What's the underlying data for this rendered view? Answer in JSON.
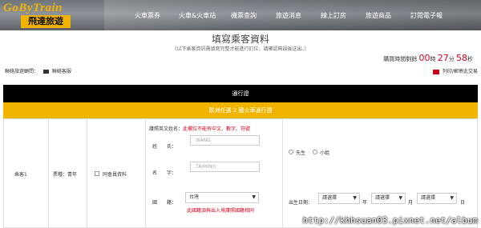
{
  "logo": {
    "en": "GoByTrain",
    "cn": "飛達旅遊"
  },
  "nav": [
    "火車票券",
    "火車&火車站",
    "機票查詢",
    "旅遊消息",
    "線上訂房",
    "旅遊商品",
    "訂閱電子報"
  ],
  "page": {
    "title": "填寫乘客資料",
    "subtitle": "(以下乘客資訊需填寫完整才能進行訂位，請確認無誤後送出。)"
  },
  "timer": {
    "label": "購買時間剩餘",
    "h": "00",
    "h_unit": "時",
    "m": "27",
    "m_unit": "分",
    "s": "58",
    "s_unit": "秒"
  },
  "contact": {
    "label": "聯絡旅遊顧問：",
    "service": "聯絡客服"
  },
  "print_label": "列印/郵寄此交易",
  "section": {
    "title": "通行證",
    "pass_name": "歐洲任選 2 國火車通行證"
  },
  "form": {
    "passenger": "乘客1",
    "ticket_type": "票種：青年",
    "member_checkbox": "同會員資料",
    "passport_label": "護照英文姓名：",
    "passport_note": "此欄位不能有中文、數字、符號",
    "surname_label": "姓　　氏：",
    "surname_placeholder": "WANG",
    "given_label": "名　　字：",
    "given_placeholder": "TAIMING",
    "gender_male": "先生",
    "gender_female": "小姐",
    "nationality_label": "國　　籍：",
    "nationality_value": "台灣",
    "nationality_note": "此國籍須與出入境護照國籍相同",
    "birth_label": "出生日期：",
    "year_value": "請選擇",
    "year_unit": "年",
    "month_value": "請選擇",
    "month_unit": "月",
    "day_value": "請選擇",
    "day_unit": "日"
  },
  "watermark": "http://khhsuan03.pixnet.net/album"
}
